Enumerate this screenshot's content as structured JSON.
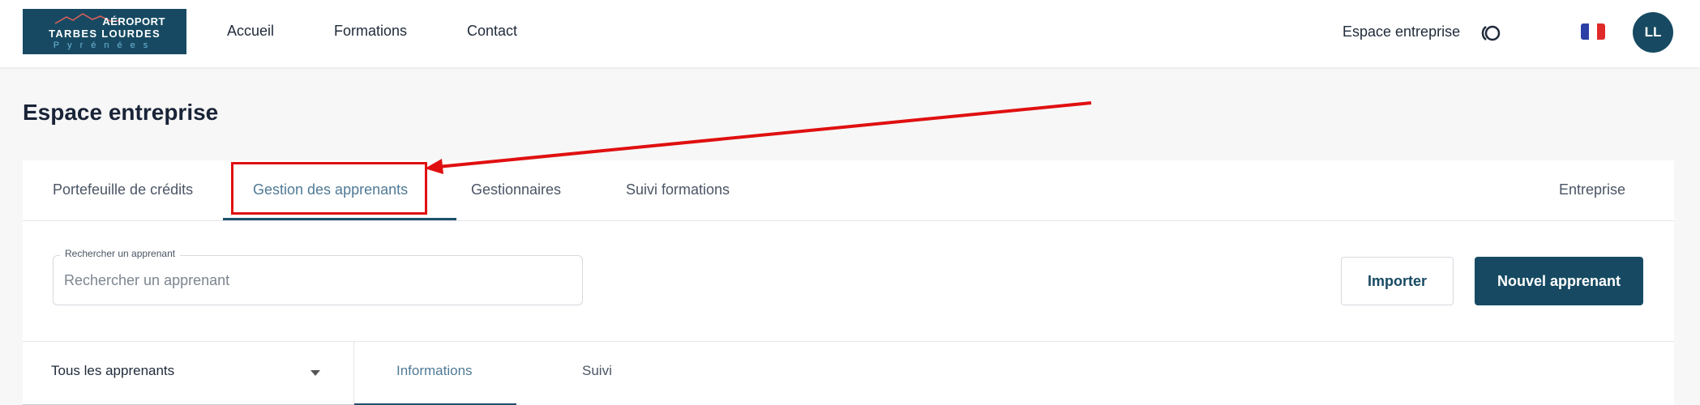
{
  "header": {
    "logo": {
      "line1": "AÉROPORT",
      "line2": "TARBES LOURDES",
      "line3": "Pyrénées"
    },
    "nav": [
      {
        "label": "Accueil"
      },
      {
        "label": "Formations"
      },
      {
        "label": "Contact"
      }
    ],
    "espace_label": "Espace entreprise",
    "language": "fr",
    "avatar_initials": "LL"
  },
  "page": {
    "title": "Espace entreprise"
  },
  "tabs": [
    {
      "label": "Portefeuille de crédits"
    },
    {
      "label": "Gestion des apprenants",
      "active": true
    },
    {
      "label": "Gestionnaires"
    },
    {
      "label": "Suivi formations"
    },
    {
      "label": "Entreprise"
    }
  ],
  "search": {
    "label": "Rechercher un apprenant",
    "placeholder": "Rechercher un apprenant",
    "value": ""
  },
  "actions": {
    "import_label": "Importer",
    "new_label": "Nouvel apprenant"
  },
  "filter": {
    "selected": "Tous les apprenants"
  },
  "subtabs": [
    {
      "label": "Informations",
      "active": true
    },
    {
      "label": "Suivi"
    }
  ],
  "colors": {
    "brand": "#174a62",
    "active_tab": "#4f7a95",
    "annotation": "#e01010"
  }
}
